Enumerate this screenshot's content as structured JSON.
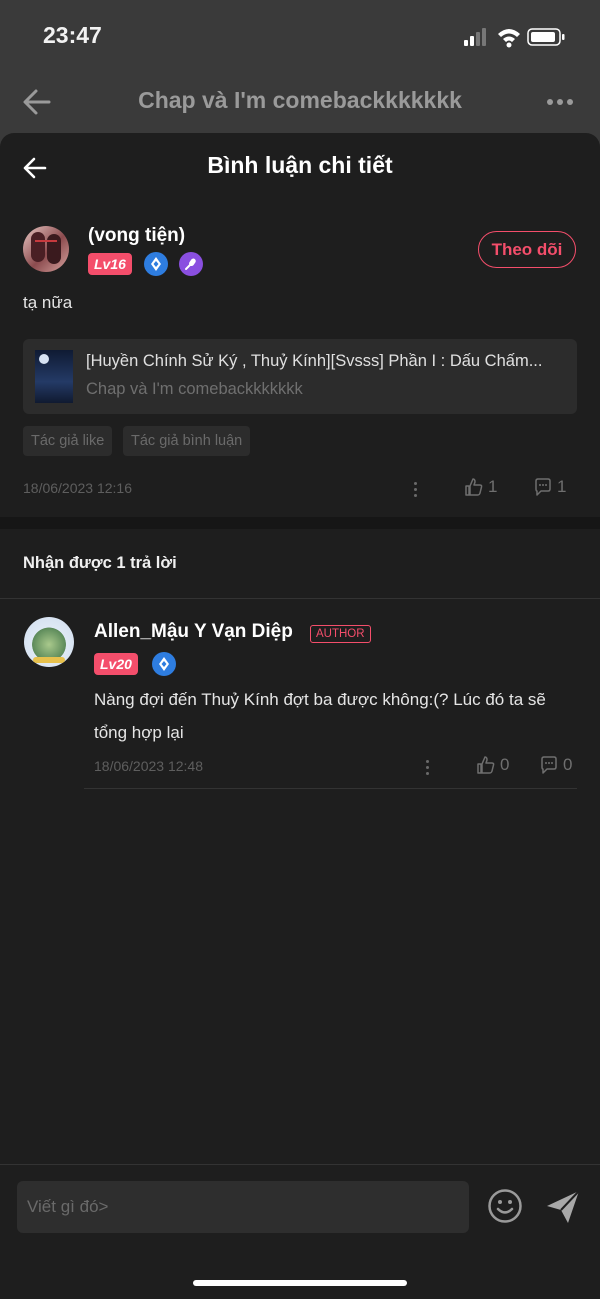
{
  "status_bar": {
    "time": "23:47"
  },
  "background_nav": {
    "title": "Chap và I'm comebackkkkkkk"
  },
  "sheet": {
    "title": "Bình luận chi tiết"
  },
  "comment": {
    "username": "(vong tiện)",
    "level": "Lv16",
    "follow_label": "Theo dõi",
    "text": "tạ nữa",
    "ref_title": "[Huyền Chính Sử Ký , Thuỷ Kính][Svsss] Phần I : Dấu Chấm...",
    "ref_subtitle": "Chap và I'm comebackkkkkkk",
    "tags": [
      "Tác giả like",
      "Tác giả bình luận"
    ],
    "date": "18/06/2023 12:16",
    "likes": "1",
    "replies": "1"
  },
  "reply_count_label": "Nhận được 1 trả lời",
  "reply": {
    "username": "Allen_Mậu Y Vạn Diệp",
    "author_badge": "AUTHOR",
    "level": "Lv20",
    "text": "Nàng đợi đến Thuỷ Kính đợt ba được không:(? Lúc đó ta sẽ tổng hợp lại",
    "date": "18/06/2023 12:48",
    "likes": "0",
    "replies": "0"
  },
  "input": {
    "placeholder": "Viết gì đó>"
  },
  "colors": {
    "accent": "#f44e6b",
    "badge_blue": "#2e7de0",
    "badge_purple": "#8a4fe0"
  }
}
